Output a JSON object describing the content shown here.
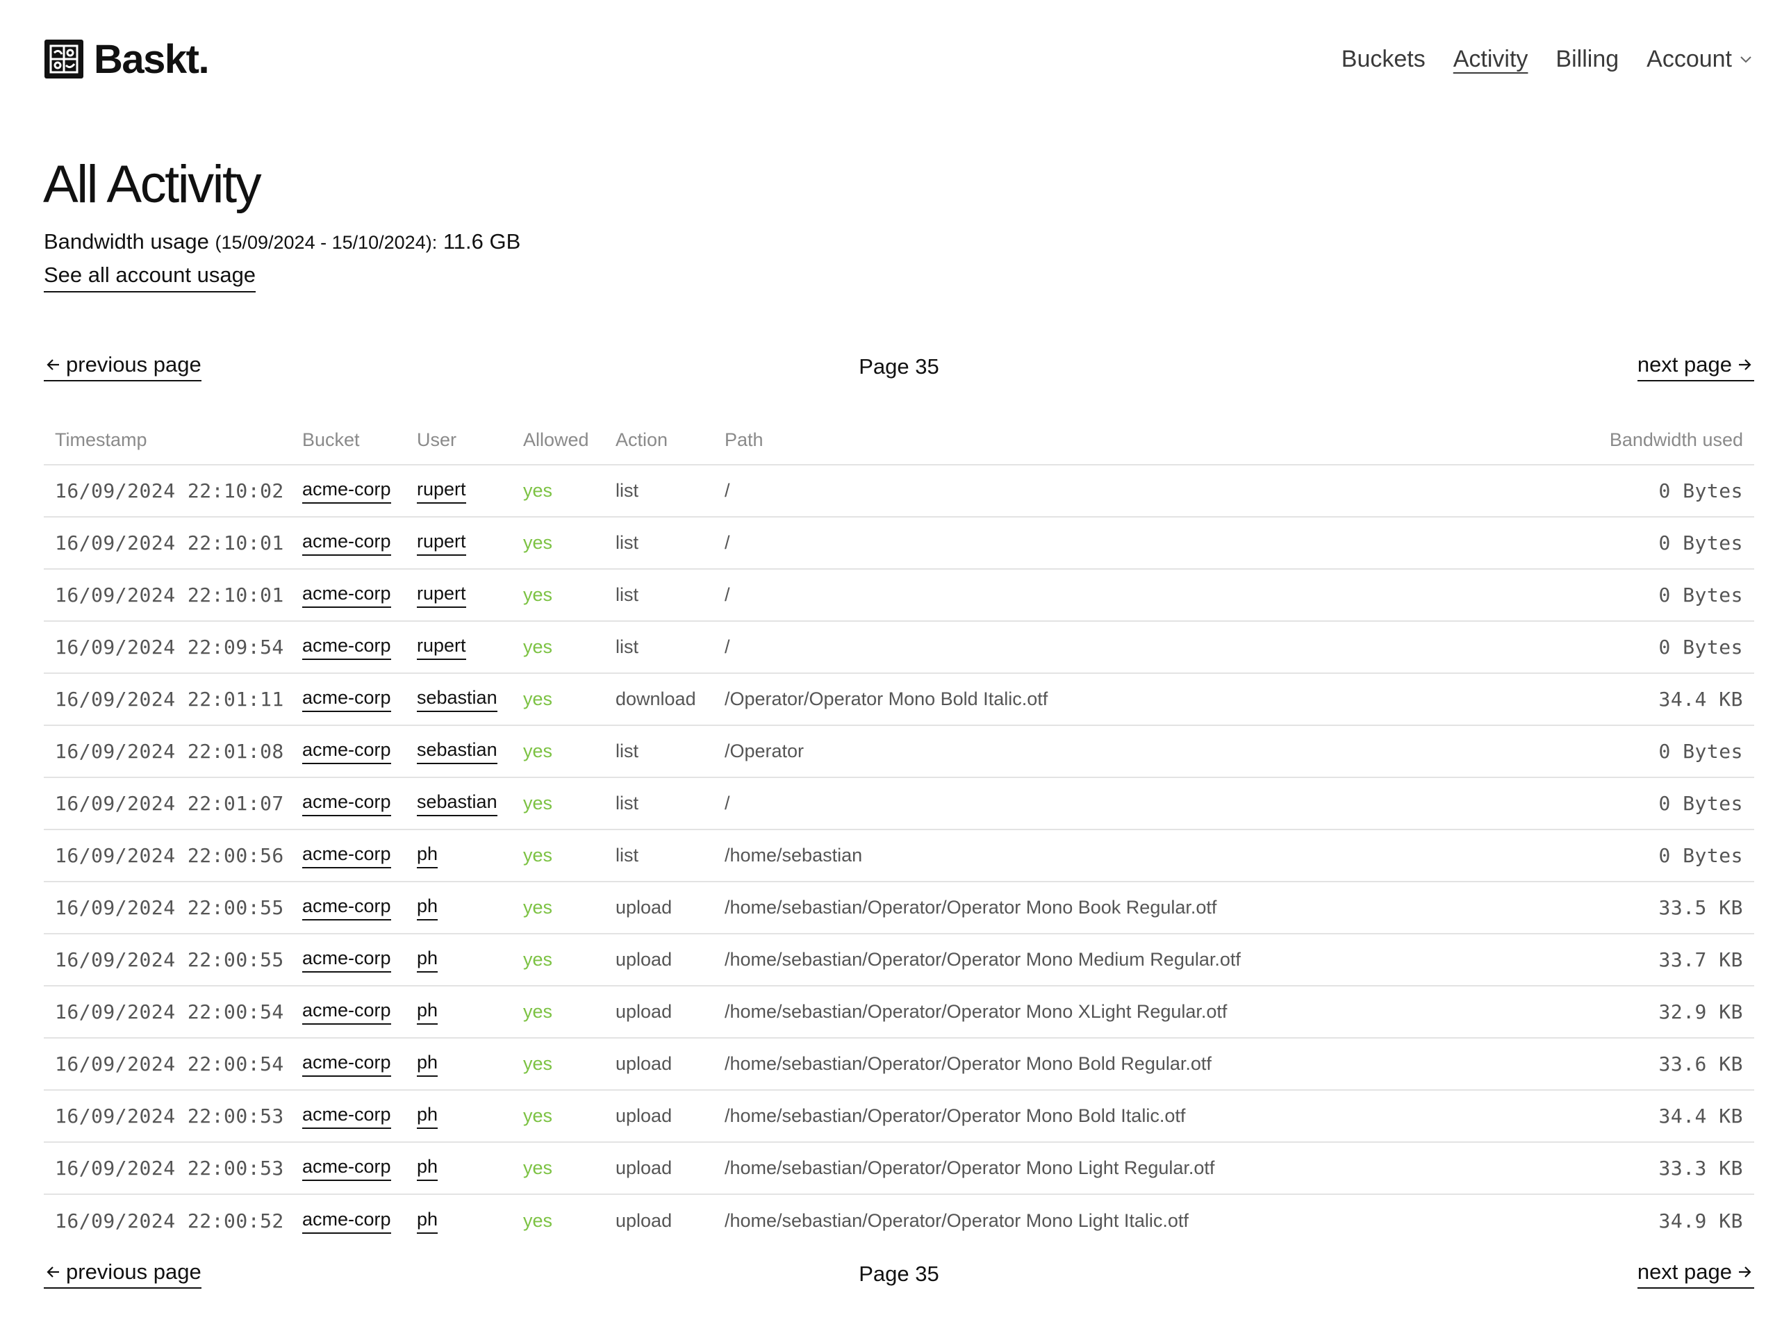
{
  "brand": {
    "name": "Baskt.",
    "logo_icon": "baskt-logo-icon"
  },
  "nav": {
    "items": [
      {
        "label": "Buckets",
        "active": false
      },
      {
        "label": "Activity",
        "active": true
      },
      {
        "label": "Billing",
        "active": false
      },
      {
        "label": "Account",
        "active": false
      }
    ]
  },
  "page": {
    "title": "All Activity",
    "bandwidth_label": "Bandwidth usage",
    "bandwidth_range": "(15/09/2024 - 15/10/2024):",
    "bandwidth_value": "11.6 GB",
    "usage_link": "See all account usage"
  },
  "pagination": {
    "previous_label": "previous page",
    "next_label": "next page",
    "page_label": "Page 35"
  },
  "table": {
    "headers": {
      "timestamp": "Timestamp",
      "bucket": "Bucket",
      "user": "User",
      "allowed": "Allowed",
      "action": "Action",
      "path": "Path",
      "bandwidth": "Bandwidth used"
    },
    "rows": [
      {
        "timestamp": "16/09/2024 22:10:02",
        "bucket": "acme-corp",
        "user": "rupert",
        "allowed": "yes",
        "action": "list",
        "path": "/",
        "bandwidth": "0 Bytes"
      },
      {
        "timestamp": "16/09/2024 22:10:01",
        "bucket": "acme-corp",
        "user": "rupert",
        "allowed": "yes",
        "action": "list",
        "path": "/",
        "bandwidth": "0 Bytes"
      },
      {
        "timestamp": "16/09/2024 22:10:01",
        "bucket": "acme-corp",
        "user": "rupert",
        "allowed": "yes",
        "action": "list",
        "path": "/",
        "bandwidth": "0 Bytes"
      },
      {
        "timestamp": "16/09/2024 22:09:54",
        "bucket": "acme-corp",
        "user": "rupert",
        "allowed": "yes",
        "action": "list",
        "path": "/",
        "bandwidth": "0 Bytes"
      },
      {
        "timestamp": "16/09/2024 22:01:11",
        "bucket": "acme-corp",
        "user": "sebastian",
        "allowed": "yes",
        "action": "download",
        "path": "/Operator/Operator Mono Bold Italic.otf",
        "bandwidth": "34.4 KB"
      },
      {
        "timestamp": "16/09/2024 22:01:08",
        "bucket": "acme-corp",
        "user": "sebastian",
        "allowed": "yes",
        "action": "list",
        "path": "/Operator",
        "bandwidth": "0 Bytes"
      },
      {
        "timestamp": "16/09/2024 22:01:07",
        "bucket": "acme-corp",
        "user": "sebastian",
        "allowed": "yes",
        "action": "list",
        "path": "/",
        "bandwidth": "0 Bytes"
      },
      {
        "timestamp": "16/09/2024 22:00:56",
        "bucket": "acme-corp",
        "user": "ph",
        "allowed": "yes",
        "action": "list",
        "path": "/home/sebastian",
        "bandwidth": "0 Bytes"
      },
      {
        "timestamp": "16/09/2024 22:00:55",
        "bucket": "acme-corp",
        "user": "ph",
        "allowed": "yes",
        "action": "upload",
        "path": "/home/sebastian/Operator/Operator Mono Book Regular.otf",
        "bandwidth": "33.5 KB"
      },
      {
        "timestamp": "16/09/2024 22:00:55",
        "bucket": "acme-corp",
        "user": "ph",
        "allowed": "yes",
        "action": "upload",
        "path": "/home/sebastian/Operator/Operator Mono Medium Regular.otf",
        "bandwidth": "33.7 KB"
      },
      {
        "timestamp": "16/09/2024 22:00:54",
        "bucket": "acme-corp",
        "user": "ph",
        "allowed": "yes",
        "action": "upload",
        "path": "/home/sebastian/Operator/Operator Mono XLight Regular.otf",
        "bandwidth": "32.9 KB"
      },
      {
        "timestamp": "16/09/2024 22:00:54",
        "bucket": "acme-corp",
        "user": "ph",
        "allowed": "yes",
        "action": "upload",
        "path": "/home/sebastian/Operator/Operator Mono Bold Regular.otf",
        "bandwidth": "33.6 KB"
      },
      {
        "timestamp": "16/09/2024 22:00:53",
        "bucket": "acme-corp",
        "user": "ph",
        "allowed": "yes",
        "action": "upload",
        "path": "/home/sebastian/Operator/Operator Mono Bold Italic.otf",
        "bandwidth": "34.4 KB"
      },
      {
        "timestamp": "16/09/2024 22:00:53",
        "bucket": "acme-corp",
        "user": "ph",
        "allowed": "yes",
        "action": "upload",
        "path": "/home/sebastian/Operator/Operator Mono Light Regular.otf",
        "bandwidth": "33.3 KB"
      },
      {
        "timestamp": "16/09/2024 22:00:52",
        "bucket": "acme-corp",
        "user": "ph",
        "allowed": "yes",
        "action": "upload",
        "path": "/home/sebastian/Operator/Operator Mono Light Italic.otf",
        "bandwidth": "34.9 KB"
      }
    ]
  },
  "colors": {
    "allowed_yes": "#7cc243",
    "text": "#111111",
    "muted": "#8a8a8a",
    "divider": "#e3e3e3"
  }
}
